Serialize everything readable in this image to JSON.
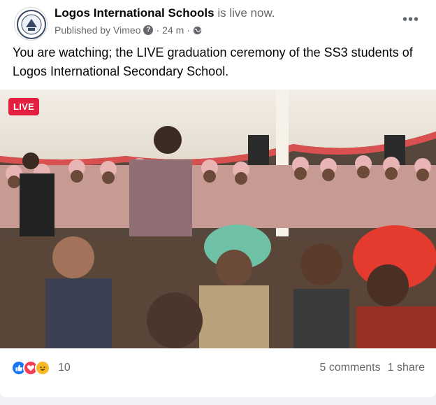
{
  "post": {
    "page_name": "Logos International Schools",
    "status_text": "is live now.",
    "published_by": "Published by Vimeo",
    "help_icon_text": "?",
    "separator": "·",
    "time": "24 m",
    "separator2": "·",
    "privacy_icon": "globe-icon",
    "more_icon": "more-horizontal-icon",
    "more_text": "•••",
    "text": "You are watching; the LIVE graduation ceremony of the SS3 students of Logos International Secondary School."
  },
  "video": {
    "live_label": "LIVE"
  },
  "footer": {
    "reactions": [
      {
        "icon": "like-icon",
        "color": "#1877f2"
      },
      {
        "icon": "love-icon",
        "color": "#f33e58"
      },
      {
        "icon": "haha-icon",
        "color": "#f7b928"
      }
    ],
    "reaction_count": "10",
    "comments": "5 comments",
    "shares": "1 share"
  },
  "colors": {
    "live_badge": "#e41e3f",
    "meta_text": "#65676b"
  }
}
